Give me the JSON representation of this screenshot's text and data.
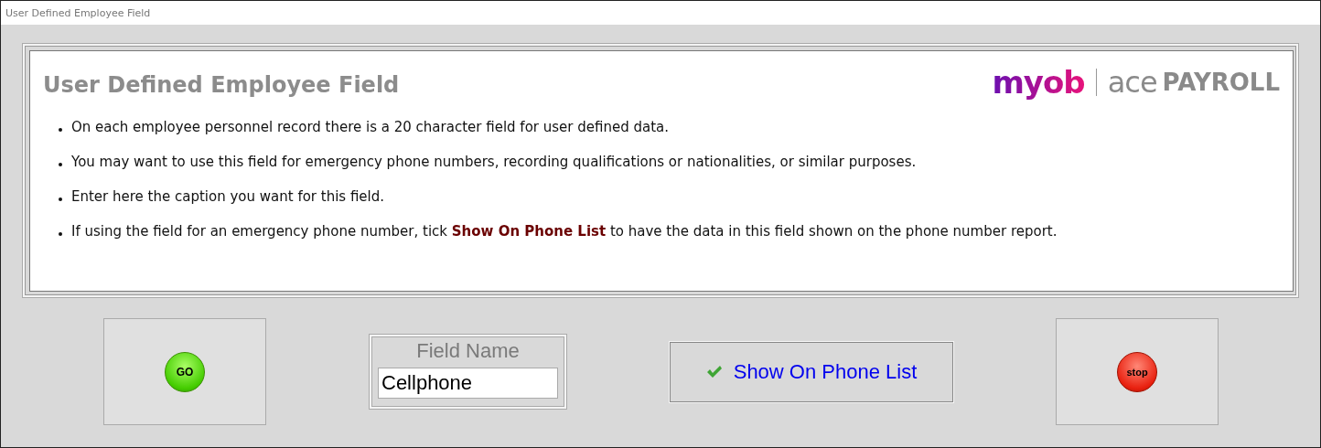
{
  "window": {
    "title": "User Defined Employee Field"
  },
  "panel": {
    "heading": "User Defined Employee Field",
    "logo": {
      "brand": "myob",
      "product": "ace",
      "suffix": "PAYROLL"
    },
    "bullets": [
      "On each employee personnel record there is a 20 character field for user defined data.",
      "You may want to use this field for emergency phone numbers, recording qualifications or nationalities, or similar purposes.",
      "Enter here the caption you want for this field.",
      "If using the field for an emergency phone number, tick **Show On Phone List** to have the data in this field shown on the phone number report."
    ]
  },
  "go_button": {
    "label": "GO"
  },
  "field_name": {
    "label": "Field Name",
    "value": "Cellphone"
  },
  "show_on_phone_list": {
    "label": "Show On Phone List",
    "checked": true
  },
  "stop_button": {
    "label": "stop"
  }
}
